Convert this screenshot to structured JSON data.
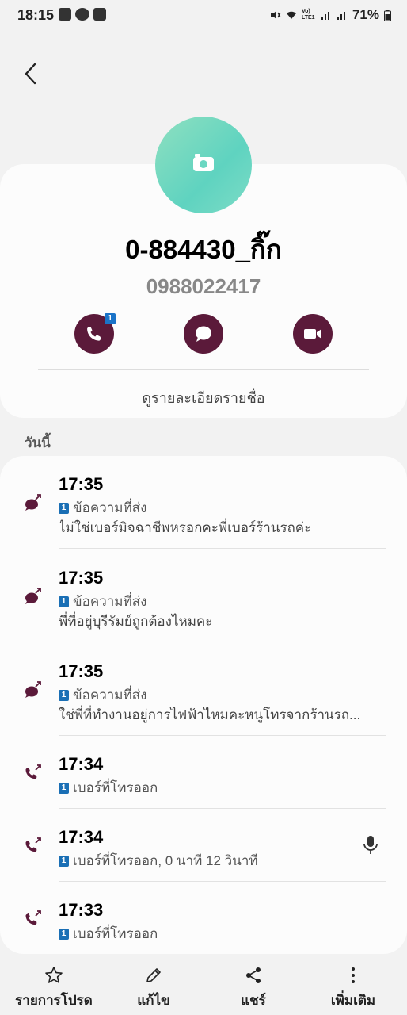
{
  "status_bar": {
    "time": "18:15",
    "battery": "71%",
    "network": "Vo) LTE1"
  },
  "contact": {
    "name": "0-884430_กิ๊ก",
    "number": "0988022417",
    "call_badge": "1",
    "details_link": "ดูรายละเอียดรายชื่อ"
  },
  "log": {
    "section_label": "วันนี้",
    "sim_label": "1",
    "entries": [
      {
        "time": "17:35",
        "type": "ข้อความที่ส่ง",
        "message": "ไม่ใช่เบอร์มิจฉาชีพหรอกคะพี่เบอร์ร้านรถค่ะ",
        "icon": "sent-message-icon"
      },
      {
        "time": "17:35",
        "type": "ข้อความที่ส่ง",
        "message": "พี่ที่อยู่บุรีรัมย์ถูกต้องไหมคะ",
        "icon": "sent-message-icon"
      },
      {
        "time": "17:35",
        "type": "ข้อความที่ส่ง",
        "message": "ใช่พี่ที่ทำงานอยู่การไฟฟ้าไหมคะหนูโทรจากร้านรถ...",
        "icon": "sent-message-icon"
      },
      {
        "time": "17:34",
        "type": "เบอร์ที่โทรออก",
        "message": "",
        "icon": "outgoing-call-icon"
      },
      {
        "time": "17:34",
        "type": "เบอร์ที่โทรออก, 0 นาที 12 วินาที",
        "message": "",
        "icon": "outgoing-call-icon"
      },
      {
        "time": "17:33",
        "type": "เบอร์ที่โทรออก",
        "message": "",
        "icon": "outgoing-call-icon"
      }
    ]
  },
  "bottom_bar": {
    "favorites": "รายการโปรด",
    "edit": "แก้ไข",
    "share": "แชร์",
    "more": "เพิ่มเติม"
  },
  "colors": {
    "accent": "#5b1a3a",
    "sim_badge": "#1a6fb5",
    "avatar": "#6bd7c2"
  }
}
